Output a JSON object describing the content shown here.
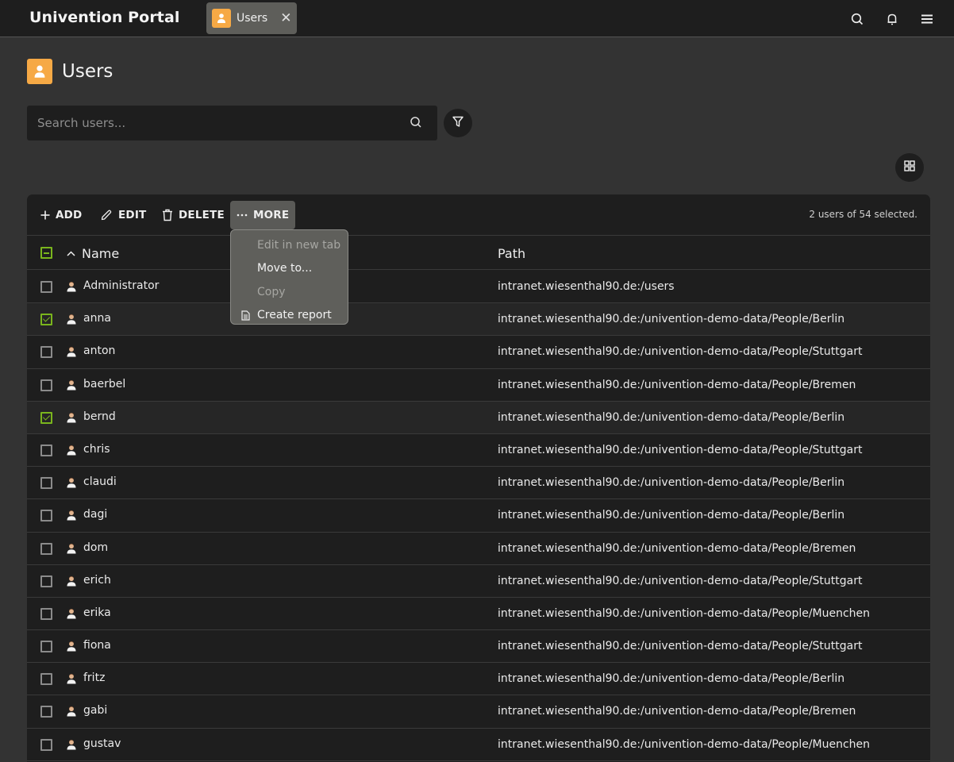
{
  "topbar": {
    "portal_title": "Univention Portal",
    "tab": {
      "label": "Users",
      "icon": "user-icon",
      "close_icon": "close-icon",
      "close_glyph": "✕"
    },
    "icons": [
      "search-icon",
      "bell-icon",
      "menu-icon"
    ]
  },
  "page": {
    "title": "Users",
    "icon": "user-icon",
    "accent_color": "#f6a945"
  },
  "search": {
    "placeholder": "Search users...",
    "value": ""
  },
  "toolbar": {
    "add_label": "ADD",
    "edit_label": "EDIT",
    "delete_label": "DELETE",
    "more_label": "MORE",
    "selection_status": "2 users of 54 selected."
  },
  "more_menu": {
    "items": [
      {
        "label": "Edit in new tab",
        "disabled": true
      },
      {
        "label": "Move to...",
        "disabled": false
      },
      {
        "label": "Copy",
        "disabled": true
      },
      {
        "label": "Create report",
        "disabled": false,
        "icon": "document-icon"
      }
    ]
  },
  "table": {
    "columns": [
      "Name",
      "Path"
    ],
    "sort": {
      "column": "Name",
      "direction": "ascending"
    },
    "header_checkbox_state": "partial",
    "check_color": "#7ab51d",
    "rows": [
      {
        "name": "Administrator",
        "path": "intranet.wiesenthal90.de:/users",
        "selected": false
      },
      {
        "name": "anna",
        "path": "intranet.wiesenthal90.de:/univention-demo-data/People/Berlin",
        "selected": true
      },
      {
        "name": "anton",
        "path": "intranet.wiesenthal90.de:/univention-demo-data/People/Stuttgart",
        "selected": false
      },
      {
        "name": "baerbel",
        "path": "intranet.wiesenthal90.de:/univention-demo-data/People/Bremen",
        "selected": false
      },
      {
        "name": "bernd",
        "path": "intranet.wiesenthal90.de:/univention-demo-data/People/Berlin",
        "selected": true
      },
      {
        "name": "chris",
        "path": "intranet.wiesenthal90.de:/univention-demo-data/People/Stuttgart",
        "selected": false
      },
      {
        "name": "claudi",
        "path": "intranet.wiesenthal90.de:/univention-demo-data/People/Berlin",
        "selected": false
      },
      {
        "name": "dagi",
        "path": "intranet.wiesenthal90.de:/univention-demo-data/People/Berlin",
        "selected": false
      },
      {
        "name": "dom",
        "path": "intranet.wiesenthal90.de:/univention-demo-data/People/Bremen",
        "selected": false
      },
      {
        "name": "erich",
        "path": "intranet.wiesenthal90.de:/univention-demo-data/People/Stuttgart",
        "selected": false
      },
      {
        "name": "erika",
        "path": "intranet.wiesenthal90.de:/univention-demo-data/People/Muenchen",
        "selected": false
      },
      {
        "name": "fiona",
        "path": "intranet.wiesenthal90.de:/univention-demo-data/People/Stuttgart",
        "selected": false
      },
      {
        "name": "fritz",
        "path": "intranet.wiesenthal90.de:/univention-demo-data/People/Berlin",
        "selected": false
      },
      {
        "name": "gabi",
        "path": "intranet.wiesenthal90.de:/univention-demo-data/People/Bremen",
        "selected": false
      },
      {
        "name": "gustav",
        "path": "intranet.wiesenthal90.de:/univention-demo-data/People/Muenchen",
        "selected": false
      }
    ]
  }
}
